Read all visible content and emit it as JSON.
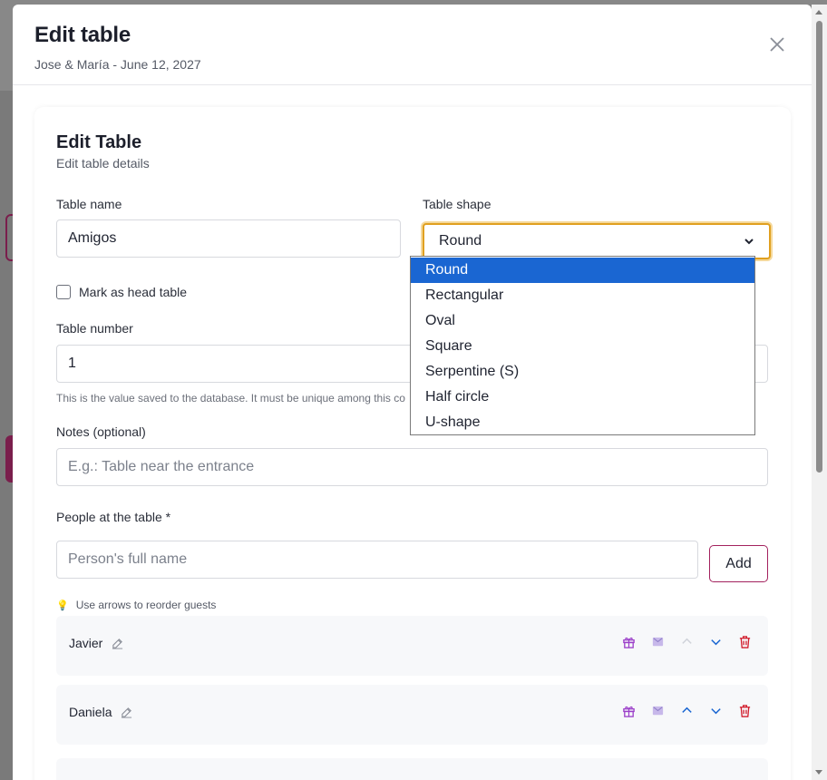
{
  "modal": {
    "title": "Edit table",
    "subtitle": "Jose & María - June 12, 2027"
  },
  "card": {
    "title": "Edit Table",
    "subtitle": "Edit table details"
  },
  "form": {
    "table_name_label": "Table name",
    "table_name_value": "Amigos",
    "table_shape_label": "Table shape",
    "table_shape_value": "Round",
    "shape_options": [
      "Round",
      "Rectangular",
      "Oval",
      "Square",
      "Serpentine (S)",
      "Half circle",
      "U-shape"
    ],
    "head_table_label": "Mark as head table",
    "table_number_label": "Table number",
    "table_number_value": "1",
    "table_number_hint": "This is the value saved to the database. It must be unique among this co",
    "notes_label": "Notes (optional)",
    "notes_placeholder": "E.g.: Table near the entrance",
    "people_label": "People at the table *",
    "person_placeholder": "Person's full name",
    "add_label": "Add",
    "reorder_hint": "Use arrows to reorder guests"
  },
  "guests": [
    {
      "name": "Javier"
    },
    {
      "name": "Daniela"
    }
  ],
  "colors": {
    "focus_border": "#e0a020",
    "selected_option": "#1a66d2",
    "accent": "#a3225e",
    "gift_icon": "#9b3fc9",
    "arrow_icon": "#1a66d2",
    "delete_icon": "#d11a2a"
  }
}
